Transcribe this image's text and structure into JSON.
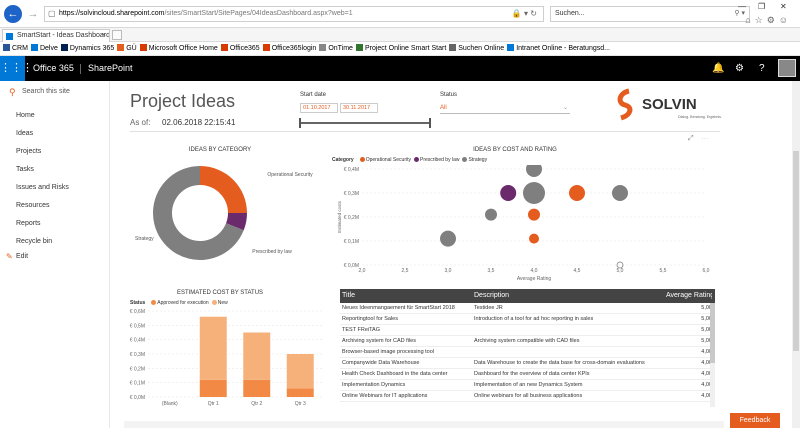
{
  "browser": {
    "url_host": "https://solvincloud.sharepoint.com",
    "url_path": "/sites/SmartStart/SitePages/04IdeasDashboard.aspx?web=1",
    "search_placeholder": "Suchen...",
    "tab_title": "SmartStart - Ideas Dashboard",
    "favorites": [
      {
        "label": "CRM",
        "color": "#2b579a"
      },
      {
        "label": "Delve",
        "color": "#0078d7"
      },
      {
        "label": "Dynamics 365",
        "color": "#002050"
      },
      {
        "label": "GÜ",
        "color": "#e55c1f"
      },
      {
        "label": "Microsoft Office Home",
        "color": "#d83b01"
      },
      {
        "label": "Office365",
        "color": "#d83b01"
      },
      {
        "label": "Office365login",
        "color": "#d83b01"
      },
      {
        "label": "OnTime",
        "color": "#888888"
      },
      {
        "label": "Project Online Smart Start",
        "color": "#31752f"
      },
      {
        "label": "Suchen Online",
        "color": "#666666"
      },
      {
        "label": "Intranet Online - Beratungsd...",
        "color": "#0078d7"
      }
    ]
  },
  "suitebar": {
    "brand": "Office 365",
    "app": "SharePoint",
    "icons": [
      "bell-icon",
      "gear-icon",
      "help-icon"
    ]
  },
  "leftnav": {
    "search_placeholder": "Search this site",
    "items": [
      "Home",
      "Ideas",
      "Projects",
      "Tasks",
      "Issues and Risks",
      "Resources",
      "Reports",
      "Recycle bin"
    ],
    "edit_label": "Edit"
  },
  "header": {
    "title": "Project Ideas",
    "as_of_label": "As of:",
    "as_of_value": "02.06.2018 22:15:41",
    "start_date_label": "Start date",
    "start_from": "01.10.2017",
    "start_to": "30.11.2017",
    "status_label": "Status",
    "status_value": "All",
    "logo_text": "SOLVIN",
    "logo_tagline": "Dialog. Beratung. Ergebnis."
  },
  "colors": {
    "accent": "#e55c1f",
    "gray": "#7f7f7f",
    "purple": "#6b2a6b",
    "peach": "#f6b17a"
  },
  "chart_data": [
    {
      "type": "pie",
      "title": "IDEAS BY CATEGORY",
      "donut": true,
      "slices": [
        {
          "name": "Operational Security",
          "value": 25,
          "color": "#e55c1f"
        },
        {
          "name": "Prescribed by law",
          "value": 6,
          "color": "#6b2a6b"
        },
        {
          "name": "Strategy",
          "value": 69,
          "color": "#7f7f7f"
        }
      ]
    },
    {
      "type": "scatter",
      "title": "IDEAS BY COST AND RATING",
      "legend_title": "Category",
      "series": [
        {
          "name": "Operational Security",
          "color": "#e55c1f"
        },
        {
          "name": "Prescribed by law",
          "color": "#6b2a6b"
        },
        {
          "name": "Strategy",
          "color": "#7f7f7f"
        }
      ],
      "xlabel": "Average Rating",
      "ylabel": "Estimated costs",
      "xlim": [
        2.0,
        6.0
      ],
      "xticks": [
        "2,0",
        "2,5",
        "3,0",
        "3,5",
        "4,0",
        "4,5",
        "5,0",
        "5,5",
        "6,0"
      ],
      "ylim": [
        0,
        0.4
      ],
      "yticks": [
        "€ 0,0M",
        "€ 0,1M",
        "€ 0,2M",
        "€ 0,3M",
        "€ 0,4M"
      ],
      "points": [
        {
          "x": 4.0,
          "y": 0.4,
          "size": 8,
          "series": 2
        },
        {
          "x": 3.7,
          "y": 0.3,
          "size": 8,
          "series": 1
        },
        {
          "x": 4.0,
          "y": 0.3,
          "size": 11,
          "series": 2
        },
        {
          "x": 4.5,
          "y": 0.3,
          "size": 8,
          "series": 0
        },
        {
          "x": 5.0,
          "y": 0.3,
          "size": 8,
          "series": 2
        },
        {
          "x": 3.5,
          "y": 0.21,
          "size": 6,
          "series": 2
        },
        {
          "x": 4.0,
          "y": 0.21,
          "size": 6,
          "series": 0
        },
        {
          "x": 3.0,
          "y": 0.11,
          "size": 8,
          "series": 2
        },
        {
          "x": 4.0,
          "y": 0.11,
          "size": 5,
          "series": 0
        },
        {
          "x": 5.0,
          "y": 0.0,
          "size": 3,
          "series": 2,
          "hollow": true
        }
      ]
    },
    {
      "type": "bar",
      "stacked": true,
      "title": "ESTIMATED COST BY STATUS",
      "legend_title": "Status",
      "categories": [
        "(Blank)",
        "Qtr 1",
        "Qtr 2",
        "Qtr 3"
      ],
      "series": [
        {
          "name": "Approved for execution",
          "color": "#f28a46",
          "values": [
            0,
            0.12,
            0.12,
            0.06
          ]
        },
        {
          "name": "New",
          "color": "#f6b17a",
          "values": [
            0,
            0.44,
            0.33,
            0.24
          ]
        }
      ],
      "ylim": [
        0,
        0.6
      ],
      "yticks": [
        "€ 0,0M",
        "€ 0,1M",
        "€ 0,2M",
        "€ 0,3M",
        "€ 0,4M",
        "€ 0,5M",
        "€ 0,6M"
      ]
    }
  ],
  "table": {
    "headers": [
      "Title",
      "Description",
      "Average Rating"
    ],
    "rows": [
      [
        "Neues Ideenmangaement für SmartStart 2018",
        "Testidee JR",
        "5,00"
      ],
      [
        "Reportingtool for Sales",
        "Introduction of a tool for ad hoc reporting in sales",
        "5,00"
      ],
      [
        "TEST FReiTAG",
        "",
        "5,00"
      ],
      [
        "Archiving system for CAD files",
        "Archiving system compatible with CAD files",
        "5,00"
      ],
      [
        "Browser-based image processing tool",
        "",
        "4,00"
      ],
      [
        "Companywide Data Warehouse",
        "Data Warehouse to create the data base for cross-domain evaluations",
        "4,00"
      ],
      [
        "Health Check Dashboard in the data center",
        "Dashboard for the overview of data center KPIs",
        "4,00"
      ],
      [
        "Implementation Dynamics",
        "Implementation of an new Dynamics System",
        "4,00"
      ],
      [
        "Online Webinars for IT applications",
        "Online webinars for all business applications",
        "4,00"
      ]
    ]
  },
  "feedback_label": "Feedback"
}
